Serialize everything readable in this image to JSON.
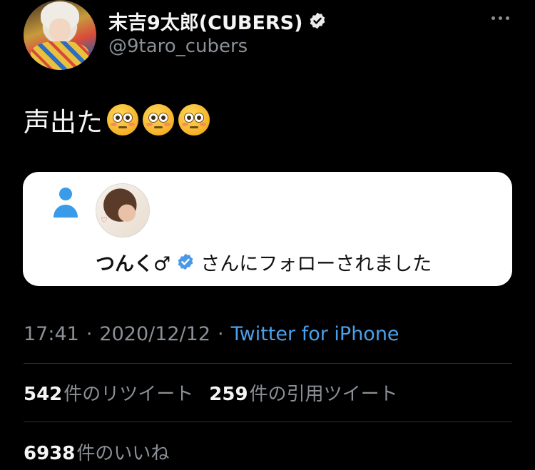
{
  "author": {
    "display_name": "末吉9太郎(CUBERS)",
    "handle": "@9taro_cubers",
    "verified": true
  },
  "tweet": {
    "text": "声出た",
    "emojis": [
      "flushed-face",
      "flushed-face",
      "flushed-face"
    ]
  },
  "embedded_card": {
    "follower_name": "つんく♂",
    "follower_verified": true,
    "follow_text": "さんにフォローされました",
    "background_color": "#ffffff"
  },
  "meta": {
    "time": "17:41",
    "date": "2020/12/12",
    "separator": "·",
    "source": "Twitter for iPhone",
    "source_color": "#4aa0ea"
  },
  "stats": {
    "retweets_count": "542",
    "retweets_label": "件のリツイート",
    "quotes_count": "259",
    "quotes_label": "件の引用ツイート",
    "likes_count": "6938",
    "likes_label": "件のいいね"
  },
  "colors": {
    "background": "#000000",
    "verified_badge": "#4a99e9",
    "muted_text": "#8b9096"
  }
}
